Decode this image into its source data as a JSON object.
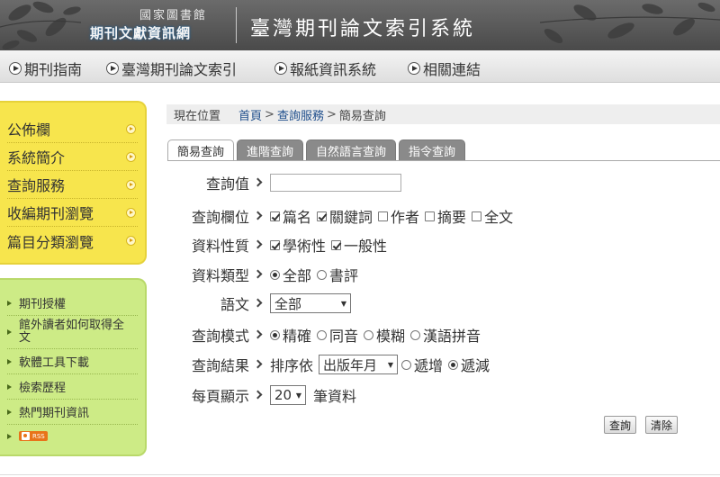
{
  "header": {
    "org_sub": "國家圖書館",
    "org_main": "期刊文獻資訊網",
    "system_title": "臺灣期刊論文索引系統"
  },
  "topnav": {
    "items": [
      {
        "label": "期刊指南"
      },
      {
        "label": "臺灣期刊論文索引"
      },
      {
        "label": "報紙資訊系統"
      },
      {
        "label": "相關連結"
      }
    ]
  },
  "yellow_menu": {
    "items": [
      {
        "label": "公佈欄"
      },
      {
        "label": "系統簡介"
      },
      {
        "label": "查詢服務"
      },
      {
        "label": "收編期刊瀏覽"
      },
      {
        "label": "篇目分類瀏覽"
      }
    ]
  },
  "green_menu": {
    "items": [
      {
        "label": "期刊授權"
      },
      {
        "label": "館外讀者如何取得全文"
      },
      {
        "label": "軟體工具下載"
      },
      {
        "label": "檢索歷程"
      },
      {
        "label": "熱門期刊資訊"
      }
    ],
    "rss_label": "RSS"
  },
  "breadcrumb": {
    "position_label": "現在位置",
    "home": "首頁",
    "sep": ">",
    "section": "查詢服務",
    "current": "簡易查詢"
  },
  "tabs": [
    {
      "label": "簡易查詢",
      "active": true
    },
    {
      "label": "進階查詢",
      "active": false
    },
    {
      "label": "自然語言查詢",
      "active": false
    },
    {
      "label": "指令查詢",
      "active": false
    }
  ],
  "form": {
    "query_value": {
      "label": "查詢值",
      "value": ""
    },
    "query_fields": {
      "label": "查詢欄位",
      "options": [
        {
          "label": "篇名",
          "checked": true
        },
        {
          "label": "關鍵詞",
          "checked": true
        },
        {
          "label": "作者",
          "checked": false
        },
        {
          "label": "摘要",
          "checked": false
        },
        {
          "label": "全文",
          "checked": false
        }
      ]
    },
    "data_nature": {
      "label": "資料性質",
      "options": [
        {
          "label": "學術性",
          "checked": true
        },
        {
          "label": "一般性",
          "checked": true
        }
      ]
    },
    "data_type": {
      "label": "資料類型",
      "options": [
        {
          "label": "全部",
          "checked": true
        },
        {
          "label": "書評",
          "checked": false
        }
      ]
    },
    "language": {
      "label": "語文",
      "selected": "全部"
    },
    "query_mode": {
      "label": "查詢模式",
      "options": [
        {
          "label": "精確",
          "checked": true
        },
        {
          "label": "同音",
          "checked": false
        },
        {
          "label": "模糊",
          "checked": false
        },
        {
          "label": "漢語拼音",
          "checked": false
        }
      ]
    },
    "query_result": {
      "label": "查詢結果",
      "sort_prefix": "排序依",
      "sort_selected": "出版年月",
      "options": [
        {
          "label": "遞增",
          "checked": false
        },
        {
          "label": "遞減",
          "checked": true
        }
      ]
    },
    "per_page": {
      "label": "每頁顯示",
      "selected": "20",
      "suffix": "筆資料"
    }
  },
  "buttons": {
    "search": "查詢",
    "clear": "清除"
  },
  "colors": {
    "header_bg": "#555555",
    "yellow_menu": "#f7e54d",
    "green_menu": "#cdeb86",
    "link_blue": "#1f4e8c",
    "inactive_tab": "#8a8a8a"
  }
}
